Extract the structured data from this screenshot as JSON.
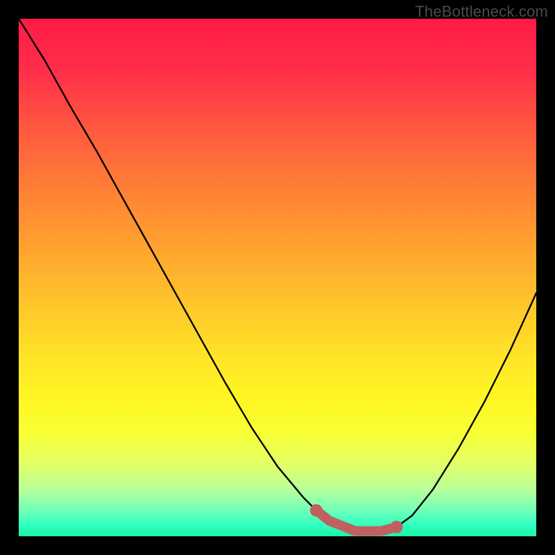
{
  "watermark": "TheBottleneck.com",
  "chart_data": {
    "type": "line",
    "title": "",
    "xlabel": "",
    "ylabel": "",
    "xlim": [
      0,
      1
    ],
    "ylim": [
      0,
      1
    ],
    "gradient_colors": {
      "top": "#ff1a47",
      "mid_upper": "#ff8335",
      "mid": "#ffe627",
      "mid_lower": "#e2ff66",
      "bottom": "#1df2a0"
    },
    "series": [
      {
        "name": "curve",
        "color": "#000000",
        "x": [
          0.0,
          0.05,
          0.1,
          0.15,
          0.2,
          0.25,
          0.3,
          0.35,
          0.4,
          0.45,
          0.5,
          0.55,
          0.575,
          0.6,
          0.65,
          0.7,
          0.73,
          0.76,
          0.8,
          0.85,
          0.9,
          0.95,
          1.0
        ],
        "y": [
          1.0,
          0.92,
          0.83,
          0.745,
          0.655,
          0.565,
          0.475,
          0.385,
          0.295,
          0.21,
          0.135,
          0.075,
          0.05,
          0.03,
          0.01,
          0.01,
          0.018,
          0.04,
          0.09,
          0.17,
          0.26,
          0.36,
          0.47
        ]
      },
      {
        "name": "marker-band",
        "color": "#c06060",
        "x": [
          0.575,
          0.6,
          0.65,
          0.7,
          0.73
        ],
        "y": [
          0.05,
          0.03,
          0.01,
          0.01,
          0.018
        ]
      }
    ],
    "markers": {
      "left_dot": {
        "x": 0.575,
        "y": 0.05
      },
      "right_dot": {
        "x": 0.73,
        "y": 0.018
      }
    }
  }
}
